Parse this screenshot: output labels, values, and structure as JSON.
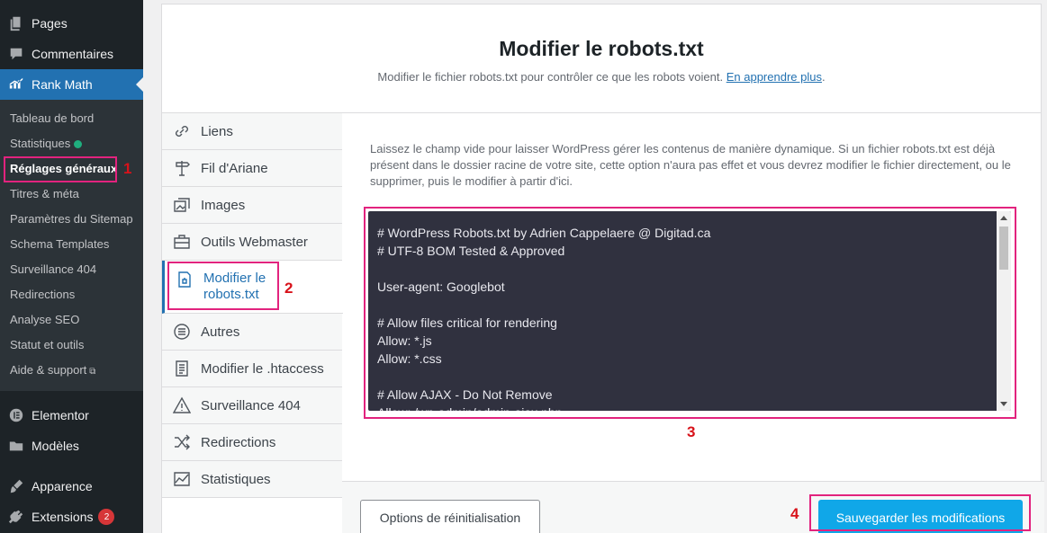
{
  "sidebar": {
    "top_items": [
      {
        "label": "Pages",
        "icon": "pages-icon"
      },
      {
        "label": "Commentaires",
        "icon": "comments-icon"
      },
      {
        "label": "Rank Math",
        "icon": "rank-math-icon"
      }
    ],
    "submenu": [
      {
        "label": "Tableau de bord"
      },
      {
        "label": "Statistiques"
      },
      {
        "label": "Réglages généraux"
      },
      {
        "label": "Titres & méta"
      },
      {
        "label": "Paramètres du Sitemap"
      },
      {
        "label": "Schema Templates"
      },
      {
        "label": "Surveillance 404"
      },
      {
        "label": "Redirections"
      },
      {
        "label": "Analyse SEO"
      },
      {
        "label": "Statut et outils"
      },
      {
        "label": "Aide & support"
      }
    ],
    "bottom_items": [
      {
        "label": "Elementor",
        "icon": "elementor-icon"
      },
      {
        "label": "Modèles",
        "icon": "folder-icon"
      },
      {
        "label": "Apparence",
        "icon": "paintbrush-icon"
      },
      {
        "label": "Extensions",
        "icon": "plugin-icon",
        "badge": "2"
      }
    ],
    "accent_color": "#2271b1"
  },
  "annotations": {
    "n1": "1",
    "n2": "2",
    "n3": "3",
    "n4": "4",
    "color": "#e2237e"
  },
  "page": {
    "title": "Modifier le robots.txt",
    "description": "Modifier le fichier robots.txt pour contrôler ce que les robots voient.",
    "learn_more": "En apprendre plus",
    "period": "."
  },
  "tabs": [
    {
      "label": "Liens",
      "icon": "link-icon"
    },
    {
      "label": "Fil d'Ariane",
      "icon": "signpost-icon"
    },
    {
      "label": "Images",
      "icon": "images-icon"
    },
    {
      "label": "Outils Webmaster",
      "icon": "briefcase-icon"
    },
    {
      "label": "Modifier le robots.txt",
      "icon": "file-robot-icon",
      "active": true
    },
    {
      "label": "Autres",
      "icon": "list-circle-icon"
    },
    {
      "label": "Modifier le .htaccess",
      "icon": "document-icon"
    },
    {
      "label": "Surveillance 404",
      "icon": "warning-icon"
    },
    {
      "label": "Redirections",
      "icon": "shuffle-icon"
    },
    {
      "label": "Statistiques",
      "icon": "chart-icon"
    }
  ],
  "help_text": "Laissez le champ vide pour laisser WordPress gérer les contenus de manière dynamique. Si un fichier robots.txt est déjà présent dans le dossier racine de votre site, cette option n'aura pas effet et vous devrez modifier le fichier directement, ou le supprimer, puis le modifier à partir d'ici.",
  "editor": {
    "content": "# WordPress Robots.txt by Adrien Cappelaere @ Digitad.ca\n# UTF-8 BOM Tested & Approved\n\nUser-agent: Googlebot\n\n# Allow files critical for rendering\nAllow: *.js\nAllow: *.css\n\n# Allow AJAX - Do Not Remove\nAllow: /wp-admin/admin-ajax.php"
  },
  "buttons": {
    "reset": "Options de réinitialisation",
    "save": "Sauvegarder les modifications"
  }
}
